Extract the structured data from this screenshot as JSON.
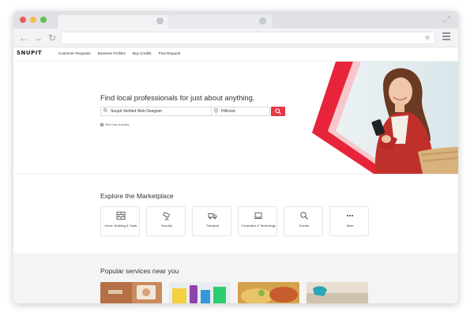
{
  "browser": {
    "traffic_lights": [
      "#ec5f57",
      "#f4bf4f",
      "#5ec14f"
    ],
    "icons": [
      "back-icon",
      "forward-icon",
      "reload-icon",
      "star-icon",
      "menu-icon",
      "expand-icon"
    ]
  },
  "site": {
    "logo": "SNUPIT",
    "nav": [
      "Customer Requests",
      "Business Profiles",
      "Buy Credits",
      "Post Request"
    ],
    "accent_color": "#e53945"
  },
  "hero": {
    "title": "Find local professionals for just about anything.",
    "search_value": "Snupit Verified Web Designer",
    "location_value": "Hillcrest",
    "how_it_works": "See how it works"
  },
  "marketplace": {
    "title": "Explore the Marketplace",
    "categories": [
      {
        "label": "Home, Building & Trade",
        "icon": "brick-wall-icon"
      },
      {
        "label": "Security",
        "icon": "security-camera-icon"
      },
      {
        "label": "Transport",
        "icon": "truck-icon"
      },
      {
        "label": "Computers & Technology",
        "icon": "computer-icon"
      },
      {
        "label": "Events",
        "icon": "magnifier-icon"
      },
      {
        "label": "More",
        "icon": "more-dots-icon"
      }
    ]
  },
  "popular": {
    "title": "Popular services near you"
  }
}
